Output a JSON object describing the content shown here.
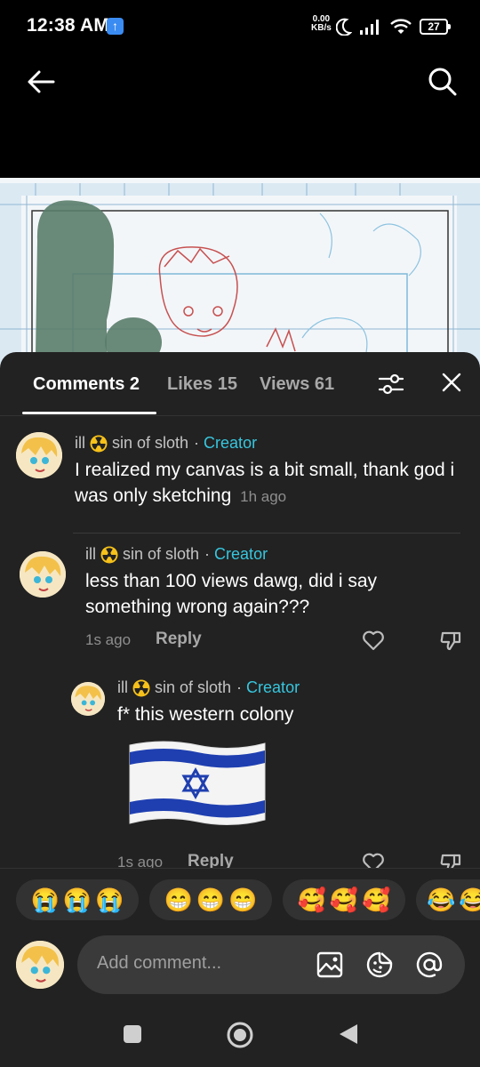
{
  "status_bar": {
    "time": "12:38 AM",
    "upload_badge": "↑",
    "speed_value": "0.00",
    "speed_unit": "KB/s",
    "battery": "27",
    "icons": [
      "moon-icon",
      "signal-icon",
      "wifi-icon",
      "battery-icon"
    ]
  },
  "topbar": {
    "icons": [
      "back-arrow-icon",
      "search-icon"
    ]
  },
  "tabs": [
    {
      "label": "Comments 2",
      "active": true
    },
    {
      "label": "Likes 15",
      "active": false
    },
    {
      "label": "Views 61",
      "active": false
    }
  ],
  "panel_icons": [
    "filter-icon",
    "close-icon"
  ],
  "comments": [
    {
      "username_prefix": "ill",
      "username_suffix": "sin of sloth",
      "separator": "·",
      "role": "Creator",
      "text": "I realized my canvas is a bit small, thank god i was only sketching",
      "time": "1h ago"
    },
    {
      "username_prefix": "ill",
      "username_suffix": "sin of sloth",
      "separator": "·",
      "role": "Creator",
      "text": "less than 100 views dawg, did i say something wrong again???",
      "time": "1s ago",
      "reply_label": "Reply"
    },
    {
      "username_prefix": "ill",
      "username_suffix": "sin of sloth",
      "separator": "·",
      "role": "Creator",
      "text": "f* this western colony",
      "time": "1s ago",
      "reply_label": "Reply",
      "sticker": "flag-sticker"
    }
  ],
  "reaction_pills": [
    [
      "😭",
      "😭",
      "😭"
    ],
    [
      "😁",
      "😁",
      "😁"
    ],
    [
      "🥰",
      "🥰",
      "🥰"
    ],
    [
      "😂",
      "😂"
    ]
  ],
  "composer": {
    "placeholder": "Add comment...",
    "icons": [
      "image-icon",
      "sticker-icon",
      "mention-icon"
    ]
  },
  "nav": {
    "icons": [
      "recents-icon",
      "home-icon",
      "back-icon"
    ]
  },
  "colors": {
    "panel_bg": "#222222",
    "creator_accent": "#37c6de",
    "muted_text": "#8e8e8e"
  }
}
